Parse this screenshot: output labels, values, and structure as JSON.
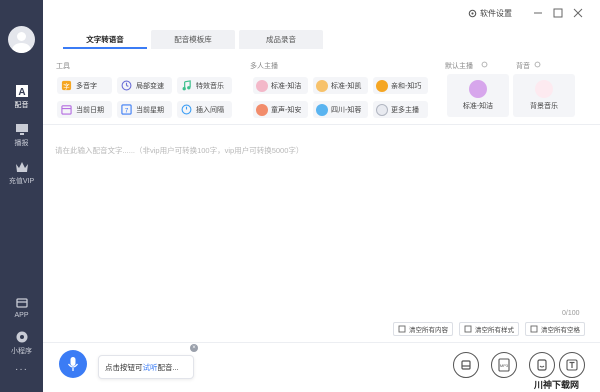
{
  "title_bar": {
    "settings_label": "软件设置"
  },
  "sidebar": {
    "items": [
      {
        "label": "配音",
        "icon": "ai-letter-icon"
      },
      {
        "label": "播报",
        "icon": "monitor-icon"
      },
      {
        "label": "充值VIP",
        "icon": "crown-icon"
      },
      {
        "label": "APP",
        "icon": "app-icon"
      },
      {
        "label": "小程序",
        "icon": "mini-program-icon"
      }
    ],
    "more": "···"
  },
  "tabs": [
    {
      "label": "文字转语音",
      "active": true
    },
    {
      "label": "配音模板库",
      "active": false
    },
    {
      "label": "成品录音",
      "active": false
    }
  ],
  "sections": {
    "tools": "工具",
    "multi_anchor": "多人主播",
    "default_anchor": "默认主播",
    "background": "背音"
  },
  "tools": [
    {
      "label": "多音字",
      "icon": "polyphone-icon"
    },
    {
      "label": "局部变速",
      "icon": "speed-icon"
    },
    {
      "label": "特效音乐",
      "icon": "music-icon"
    },
    {
      "label": "当前日期",
      "icon": "calendar-icon"
    },
    {
      "label": "当前星期",
      "icon": "week-icon"
    },
    {
      "label": "插入间隔",
      "icon": "interval-icon"
    }
  ],
  "anchors": [
    {
      "label": "标准-知洁"
    },
    {
      "label": "标准-知凯"
    },
    {
      "label": "亲和-知巧"
    },
    {
      "label": "童声-知安"
    },
    {
      "label": "四川-知蓉"
    },
    {
      "label": "更多主播"
    }
  ],
  "default_anchor": {
    "label": "标准-知洁"
  },
  "background_music": {
    "label": "背景音乐"
  },
  "editor": {
    "placeholder": "请在此输入配音文字......（非vip用户可转换100字，vip用户可转换5000字）",
    "counter": "0/100"
  },
  "actions": {
    "clear_content": "清空所有内容",
    "clear_style": "清空所有样式",
    "clear_space": "清空所有空格"
  },
  "bottom": {
    "hint_prefix": "点击按钮可",
    "hint_link": "试听",
    "hint_suffix": "配音...",
    "close": "×"
  },
  "watermark": "川神下载网",
  "colors": {
    "sidebar": "#343b52",
    "accent": "#3b7cf5"
  }
}
